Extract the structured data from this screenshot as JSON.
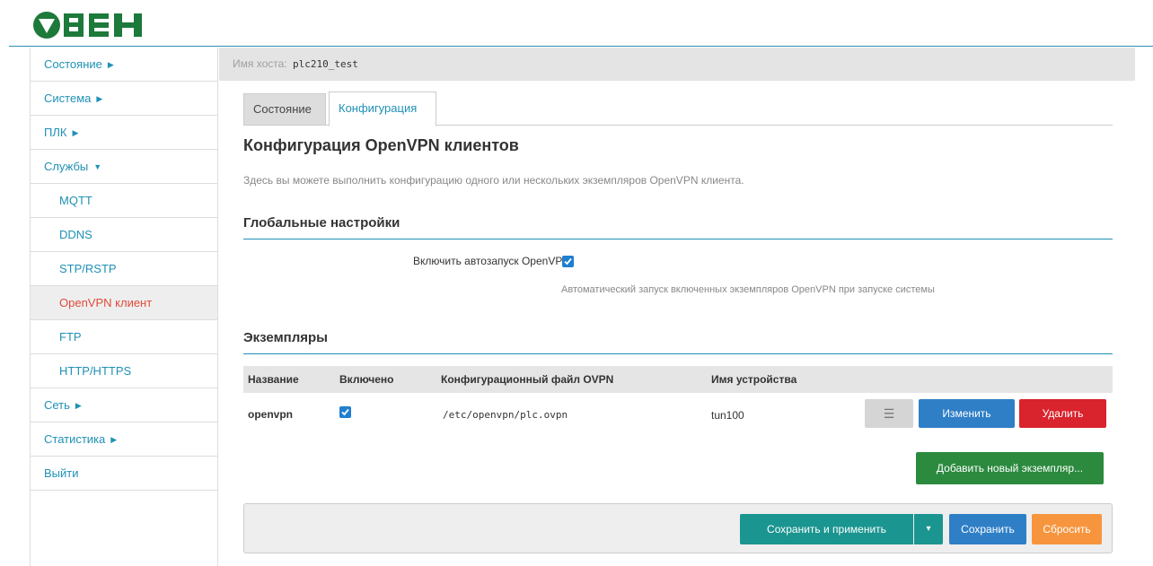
{
  "brand": {
    "logo_text": "ОВЕН",
    "accent": "#1f91b5",
    "logo_color": "#1d7a3a"
  },
  "sidebar": {
    "items": [
      {
        "label": "Состояние",
        "caret": "▶"
      },
      {
        "label": "Система",
        "caret": "▶"
      },
      {
        "label": "ПЛК",
        "caret": "▶"
      },
      {
        "label": "Службы",
        "caret": "▼"
      },
      {
        "label": "MQTT"
      },
      {
        "label": "DDNS"
      },
      {
        "label": "STP/RSTP"
      },
      {
        "label": "OpenVPN клиент"
      },
      {
        "label": "FTP"
      },
      {
        "label": "HTTP/HTTPS"
      },
      {
        "label": "Сеть",
        "caret": "▶"
      },
      {
        "label": "Статистика",
        "caret": "▶"
      },
      {
        "label": "Выйти"
      }
    ]
  },
  "hostbar": {
    "label": "Имя хоста:",
    "value": "plc210_test"
  },
  "tabs": [
    {
      "label": "Состояние"
    },
    {
      "label": "Конфигурация"
    }
  ],
  "page": {
    "title": "Конфигурация OpenVPN клиентов",
    "description": "Здесь вы можете выполнить конфигурацию одного или нескольких экземпляров OpenVPN клиента."
  },
  "global": {
    "title": "Глобальные настройки",
    "autostart_label": "Включить автозапуск OpenVPN",
    "autostart_checked": true,
    "autostart_help": "Автоматический запуск включенных экземпляров OpenVPN при запуске системы"
  },
  "instances": {
    "title": "Экземпляры",
    "columns": [
      "Название",
      "Включено",
      "Конфигурационный файл OVPN",
      "Имя устройства"
    ],
    "rows": [
      {
        "name": "openvpn",
        "enabled": true,
        "file": "/etc/openvpn/plc.ovpn",
        "device": "tun100"
      }
    ],
    "row_actions": {
      "menu": "☰",
      "edit": "Изменить",
      "delete": "Удалить"
    },
    "add_label": "Добавить новый экземпляр..."
  },
  "footer": {
    "save_apply": "Сохранить и применить",
    "dropdown": "▾",
    "save": "Сохранить",
    "reset": "Сбросить"
  }
}
